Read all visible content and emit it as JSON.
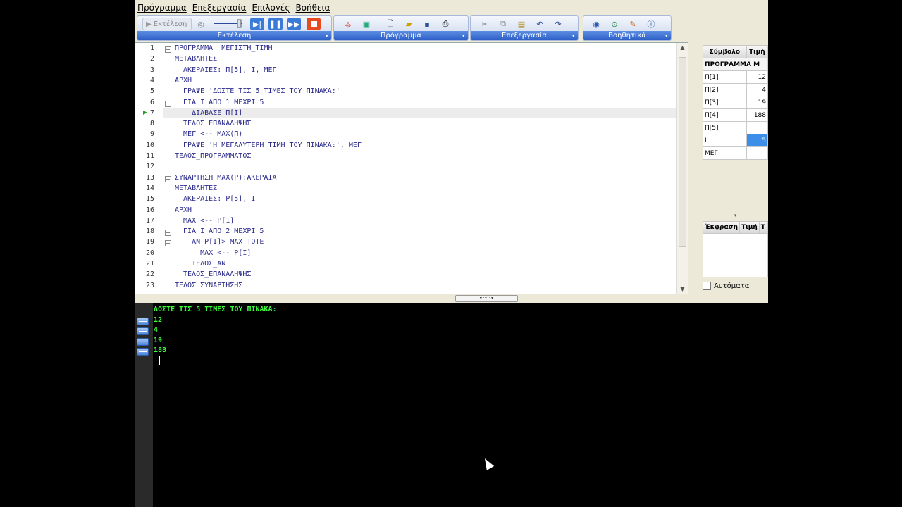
{
  "menu": [
    "Πρόγραμμα",
    "Επεξεργασία",
    "Επιλογές",
    "Βοήθεια"
  ],
  "toolbars": {
    "run": {
      "title": "Εκτέλεση",
      "run_label": "Εκτέλεση"
    },
    "program": {
      "title": "Πρόγραμμα"
    },
    "edit": {
      "title": "Επεξεργασία"
    },
    "tools": {
      "title": "Βοηθητικά"
    }
  },
  "editor": {
    "current_line": 7,
    "lines": [
      "ΠΡΟΓΡΑΜΜΑ  ΜΕΓΙΣΤΗ_ΤΙΜΗ",
      "ΜΕΤΑΒΛΗΤΕΣ",
      "  ΑΚΕΡΑΙΕΣ: Π[5], Ι, ΜΕΓ",
      "ΑΡΧΗ",
      "  ΓΡΑΨΕ 'ΔΩΣΤΕ ΤΙΣ 5 ΤΙΜΕΣ ΤΟΥ ΠΙΝΑΚΑ:'",
      "  ΓΙΑ Ι ΑΠΟ 1 ΜΕΧΡΙ 5",
      "    ΔΙΑΒΑΣΕ Π[Ι]",
      "  ΤΕΛΟΣ_ΕΠΑΝΑΛΗΨΗΣ",
      "  ΜΕΓ <-- ΜΑΧ(Π)",
      "  ΓΡΑΨΕ 'Η ΜΕΓΑΛΥΤΕΡΗ ΤΙΜΗ ΤΟΥ ΠΙΝΑΚΑ:', ΜΕΓ",
      "ΤΕΛΟΣ_ΠΡΟΓΡΑΜΜΑΤΟΣ",
      "",
      "ΣΥΝΑΡΤΗΣΗ ΜΑΧ(Ρ):ΑΚΕΡΑΙΑ",
      "ΜΕΤΑΒΛΗΤΕΣ",
      "  ΑΚΕΡΑΙΕΣ: Ρ[5], Ι",
      "ΑΡΧΗ",
      "  ΜΑΧ <-- Ρ[1]",
      "  ΓΙΑ Ι ΑΠΟ 2 ΜΕΧΡΙ 5",
      "    ΑΝ Ρ[Ι]> ΜΑΧ ΤΟΤΕ",
      "      ΜΑΧ <-- Ρ[Ι]",
      "    ΤΕΛΟΣ_ΑΝ",
      "  ΤΕΛΟΣ_ΕΠΑΝΑΛΗΨΗΣ",
      "ΤΕΛΟΣ_ΣΥΝΑΡΤΗΣΗΣ"
    ],
    "line_numbers": [
      "1",
      "2",
      "3",
      "4",
      "5",
      "6",
      "7",
      "8",
      "9",
      "10",
      "11",
      "12",
      "13",
      "14",
      "15",
      "16",
      "17",
      "18",
      "19",
      "20",
      "21",
      "22",
      "23"
    ]
  },
  "symbols": {
    "header_name": "Σύμβολο",
    "header_value": "Τιμή",
    "program_row": "ΠΡΟΓΡΑΜΜΑ Μ",
    "rows": [
      {
        "name": "Π[1]",
        "value": "12"
      },
      {
        "name": "Π[2]",
        "value": "4"
      },
      {
        "name": "Π[3]",
        "value": "19"
      },
      {
        "name": "Π[4]",
        "value": "188"
      },
      {
        "name": "Π[5]",
        "value": ""
      },
      {
        "name": "Ι",
        "value": "5"
      },
      {
        "name": "ΜΕΓ",
        "value": ""
      }
    ]
  },
  "expressions": {
    "header_expr": "Έκφραση",
    "header_value": "Τιμή",
    "header_type": "Τ",
    "auto_label": "Αυτόματα"
  },
  "console": {
    "lines": [
      "ΔΩΣΤΕ ΤΙΣ 5 ΤΙΜΕΣ ΤΟΥ ΠΙΝΑΚΑ:",
      "12",
      "4",
      "19",
      "188"
    ],
    "text_color": "#3cff3c"
  }
}
